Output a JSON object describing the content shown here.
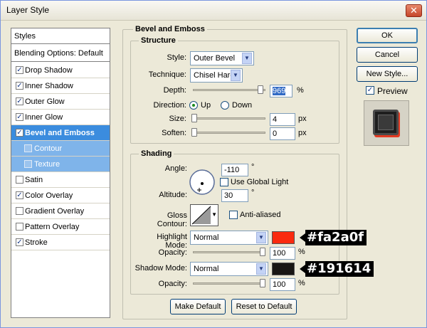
{
  "window": {
    "title": "Layer Style",
    "close_glyph": "✕"
  },
  "styles_list": {
    "header": "Styles",
    "blending": "Blending Options: Default",
    "items": [
      {
        "label": "Drop Shadow",
        "checked": true
      },
      {
        "label": "Inner Shadow",
        "checked": true
      },
      {
        "label": "Outer Glow",
        "checked": true
      },
      {
        "label": "Inner Glow",
        "checked": true
      },
      {
        "label": "Bevel and Emboss",
        "checked": true,
        "selected": true
      },
      {
        "label": "Contour",
        "checked": false,
        "sub": true
      },
      {
        "label": "Texture",
        "checked": false,
        "sub": true
      },
      {
        "label": "Satin",
        "checked": false
      },
      {
        "label": "Color Overlay",
        "checked": true
      },
      {
        "label": "Gradient Overlay",
        "checked": false
      },
      {
        "label": "Pattern Overlay",
        "checked": false
      },
      {
        "label": "Stroke",
        "checked": true
      }
    ]
  },
  "bevel": {
    "section_title": "Bevel and Emboss",
    "structure": {
      "title": "Structure",
      "style_label": "Style:",
      "style_value": "Outer Bevel",
      "technique_label": "Technique:",
      "technique_value": "Chisel Hard",
      "depth_label": "Depth:",
      "depth_value": "969",
      "depth_unit": "%",
      "direction_label": "Direction:",
      "direction_up": "Up",
      "direction_down": "Down",
      "size_label": "Size:",
      "size_value": "4",
      "size_unit": "px",
      "soften_label": "Soften:",
      "soften_value": "0",
      "soften_unit": "px"
    },
    "shading": {
      "title": "Shading",
      "angle_label": "Angle:",
      "angle_value": "-110",
      "angle_unit": "°",
      "global_light": "Use Global Light",
      "altitude_label": "Altitude:",
      "altitude_value": "30",
      "altitude_unit": "°",
      "gloss_label": "Gloss Contour:",
      "anti_aliased": "Anti-aliased",
      "highlight_label": "Highlight Mode:",
      "highlight_mode": "Normal",
      "highlight_color": "#fa2a0f",
      "highlight_callout": "#fa2a0f",
      "hl_opacity_label": "Opacity:",
      "hl_opacity_value": "100",
      "hl_opacity_unit": "%",
      "shadow_label": "Shadow Mode:",
      "shadow_mode": "Normal",
      "shadow_color": "#191614",
      "shadow_callout": "#191614",
      "sh_opacity_label": "Opacity:",
      "sh_opacity_value": "100",
      "sh_opacity_unit": "%"
    },
    "make_default": "Make Default",
    "reset_default": "Reset to Default"
  },
  "actions": {
    "ok": "OK",
    "cancel": "Cancel",
    "new_style": "New Style...",
    "preview": "Preview"
  }
}
